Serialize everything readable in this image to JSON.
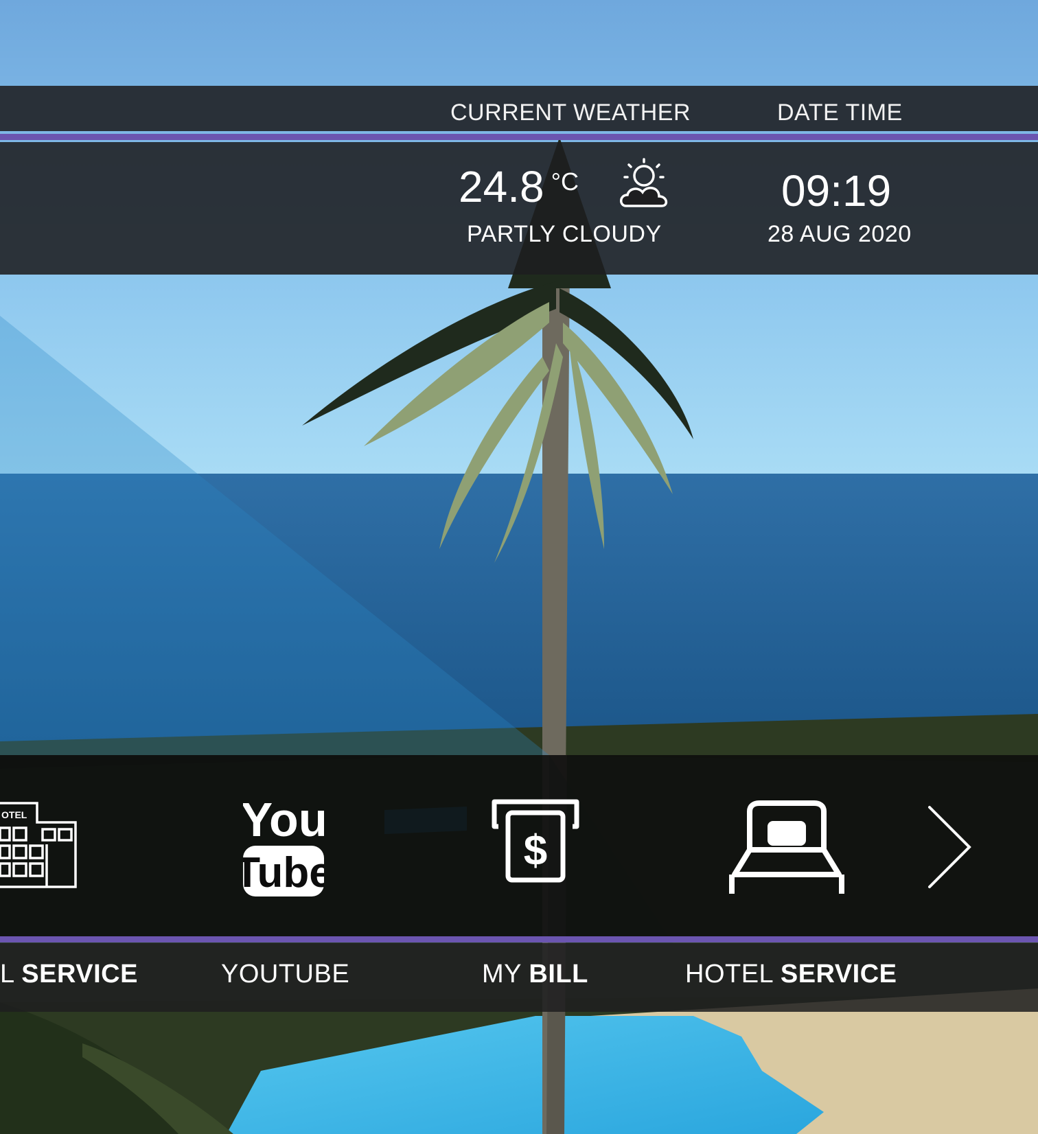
{
  "header": {
    "weather_label": "CURRENT WEATHER",
    "datetime_label": "DATE TIME"
  },
  "weather": {
    "temperature": "24.8",
    "unit": "°C",
    "condition": "PARTLY CLOUDY",
    "icon": "partly-cloudy-icon"
  },
  "datetime": {
    "time": "09:19",
    "date": "28 AUG 2020"
  },
  "menu": {
    "items": [
      {
        "icon": "hotel-building-icon",
        "label_light": "L",
        "label_bold": "SERVICE",
        "icon_text": "OTEL"
      },
      {
        "icon": "youtube-icon",
        "label_light": "YOUTUBE",
        "label_bold": "",
        "icon_text_top": "You",
        "icon_text_bottom": "Tube"
      },
      {
        "icon": "bill-receipt-icon",
        "label_light": "MY",
        "label_bold": "BILL",
        "icon_text": "$"
      },
      {
        "icon": "bed-icon",
        "label_light": "HOTEL",
        "label_bold": "SERVICE"
      }
    ],
    "next": "chevron-right-icon"
  },
  "colors": {
    "accent_purple": "#6b55b0",
    "bar_dark": "#1e1e20"
  }
}
